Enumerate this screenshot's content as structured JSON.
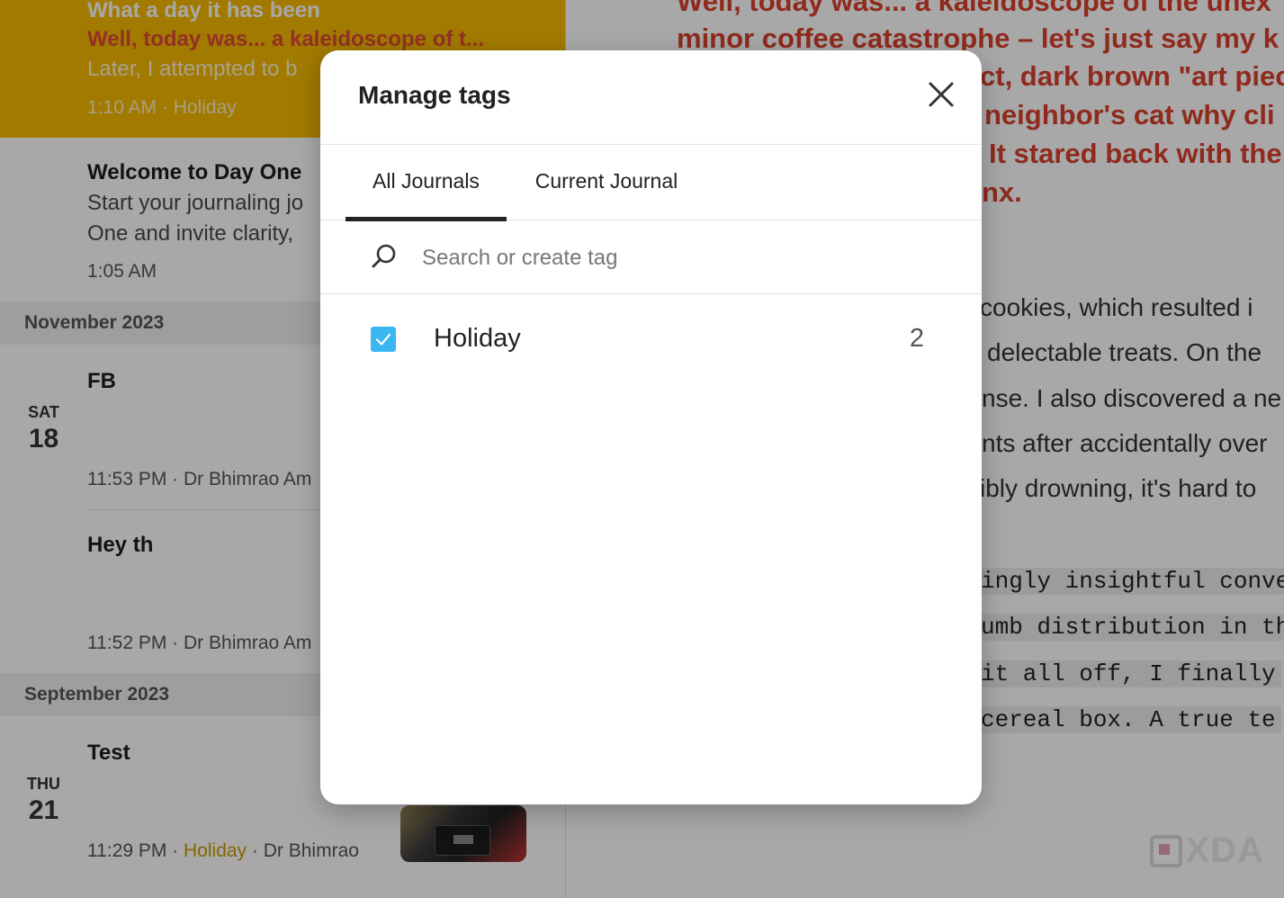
{
  "sidebar": {
    "selected_entry": {
      "title": "What a day it has been",
      "excerpt_highlight": "Well, today was... a kaleidoscope of t...",
      "excerpt": "Later, I attempted to b",
      "time": "1:10 AM",
      "tag": "Holiday"
    },
    "entries": [
      {
        "title": "Welcome to Day One",
        "excerpt_line1": "Start your journaling jo",
        "excerpt_line2": "One and invite clarity,",
        "time": "1:05 AM"
      }
    ],
    "months": [
      {
        "label": "November 2023",
        "day": {
          "dow": "SAT",
          "num": "18"
        },
        "entries": [
          {
            "title": "FB",
            "time": "11:53 PM",
            "journal": "Dr Bhimrao Am"
          },
          {
            "title": "Hey th",
            "time": "11:52 PM",
            "journal": "Dr Bhimrao Am"
          }
        ]
      },
      {
        "label": "September 2023",
        "day": {
          "dow": "THU",
          "num": "21"
        },
        "entries": [
          {
            "title": "Test",
            "time": "11:29 PM",
            "tag": "Holiday",
            "journal": "Dr Bhimrao"
          }
        ]
      }
    ],
    "separator": "·"
  },
  "editor": {
    "red_lines": [
      "Well, today was... a kaleidoscope of the unex",
      "minor coffee catastrophe – let's just say my k",
      "ct, dark brown \"art piec",
      "neighbor's cat why cli",
      "It stared back with the",
      "nx."
    ],
    "body_lines": [
      "cookies, which resulted i",
      "delectable treats. On the",
      "nse. I also discovered a ne",
      "nts after accidentally over",
      "ibly drowning, it's hard to"
    ],
    "code_lines": [
      "ingly insightful conver",
      "umb distribution in th",
      "it all off, I finally",
      " cereal box. A true te"
    ]
  },
  "watermark": {
    "text": "XDA"
  },
  "modal": {
    "title": "Manage tags",
    "tabs": [
      {
        "label": "All Journals",
        "active": true
      },
      {
        "label": "Current Journal",
        "active": false
      }
    ],
    "search": {
      "placeholder": "Search or create tag",
      "value": ""
    },
    "tags": [
      {
        "name": "Holiday",
        "count": "2",
        "checked": true
      }
    ],
    "icons": {
      "close": "close-icon",
      "search": "search-icon",
      "check": "checkmark-icon"
    }
  },
  "colors": {
    "accent_yellow": "#f6b900",
    "checkbox_blue": "#3ab6f0",
    "highlight_red": "#d9412d"
  }
}
